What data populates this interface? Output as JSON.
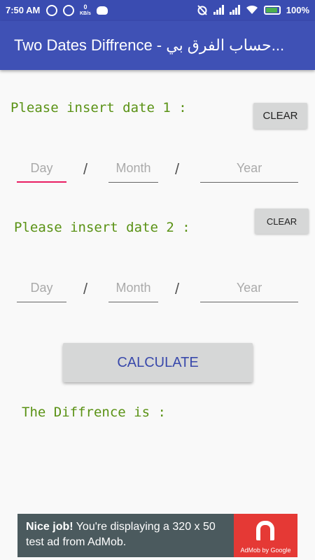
{
  "status_bar": {
    "time": "7:50 AM",
    "net_speed_value": "0",
    "net_speed_unit": "KB/s",
    "battery_percent": "100%",
    "icons": [
      "sync-icon",
      "sync-icon",
      "network-speed-icon",
      "cat-icon",
      "alarm-off-icon",
      "signal-icon",
      "signal-icon",
      "wifi-icon",
      "battery-icon"
    ]
  },
  "app_bar": {
    "title": "Two Dates Diffrence - حساب الفرق بي..."
  },
  "date1": {
    "prompt": "Please insert date 1 :",
    "clear_label": "CLEAR",
    "day_placeholder": "Day",
    "month_placeholder": "Month",
    "year_placeholder": "Year",
    "separator": "/"
  },
  "date2": {
    "prompt": "Please insert date 2 :",
    "clear_label": "CLEAR",
    "day_placeholder": "Day",
    "month_placeholder": "Month",
    "year_placeholder": "Year",
    "separator": "/"
  },
  "calculate_label": "CALCULATE",
  "result_label": "The Diffrence is :",
  "ad": {
    "headline": "Nice job!",
    "body": "You're displaying a 320 x 50 test ad from AdMob.",
    "logo_caption": "AdMob by Google"
  },
  "colors": {
    "status_bar": "#3a4cb1",
    "app_bar": "#3f51b5",
    "prompt_text": "#5a9215",
    "active_underline": "#e91e63",
    "calculate_text": "#3949ab",
    "ad_background": "#4b5a5e",
    "ad_logo": "#e53935"
  }
}
